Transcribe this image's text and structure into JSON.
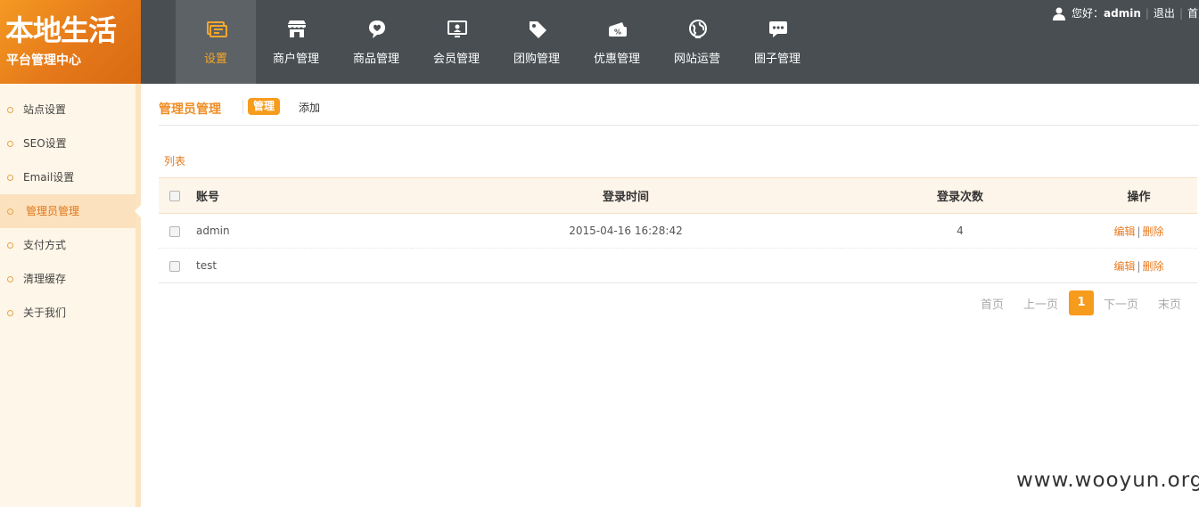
{
  "logo": {
    "title": "本地生活",
    "subtitle": "平台管理中心"
  },
  "nav": [
    {
      "label": "设置",
      "icon": "settings-card-icon",
      "active": true
    },
    {
      "label": "商户管理",
      "icon": "store-icon"
    },
    {
      "label": "商品管理",
      "icon": "product-tag-bubble-icon"
    },
    {
      "label": "会员管理",
      "icon": "member-monitor-icon"
    },
    {
      "label": "团购管理",
      "icon": "price-tag-icon"
    },
    {
      "label": "优惠管理",
      "icon": "coupon-icon"
    },
    {
      "label": "网站运营",
      "icon": "globe-icon"
    },
    {
      "label": "圈子管理",
      "icon": "chat-bubble-icon"
    }
  ],
  "topbar": {
    "greeting": "您好：",
    "username": "admin",
    "logout": "退出",
    "home": "首页",
    "sep": "|"
  },
  "sidebar": {
    "items": [
      {
        "label": "站点设置"
      },
      {
        "label": "SEO设置"
      },
      {
        "label": "Email设置"
      },
      {
        "label": "管理员管理",
        "active": true
      },
      {
        "label": "支付方式"
      },
      {
        "label": "清理缓存"
      },
      {
        "label": "关于我们"
      }
    ]
  },
  "main": {
    "title": "管理员管理",
    "tab_manage": "管理",
    "tab_add": "添加",
    "list_title": "列表",
    "columns": {
      "account": "账号",
      "login_time": "登录时间",
      "login_count": "登录次数",
      "actions": "操作"
    },
    "rows": [
      {
        "account": "admin",
        "login_time": "2015-04-16 16:28:42",
        "login_count": "4",
        "edit": "编辑",
        "delete": "删除",
        "sep": "|"
      },
      {
        "account": "test",
        "login_time": "",
        "login_count": "",
        "edit": "编辑",
        "delete": "删除",
        "sep": "|"
      }
    ],
    "pager": {
      "first": "首页",
      "prev": "上一页",
      "current": "1",
      "next": "下一页",
      "last": "末页"
    }
  },
  "watermark": "www.wooyun.org",
  "colors": {
    "accent": "#f79b1c",
    "header_bg": "#484e52",
    "sidebar_bg": "#fef6e8"
  }
}
